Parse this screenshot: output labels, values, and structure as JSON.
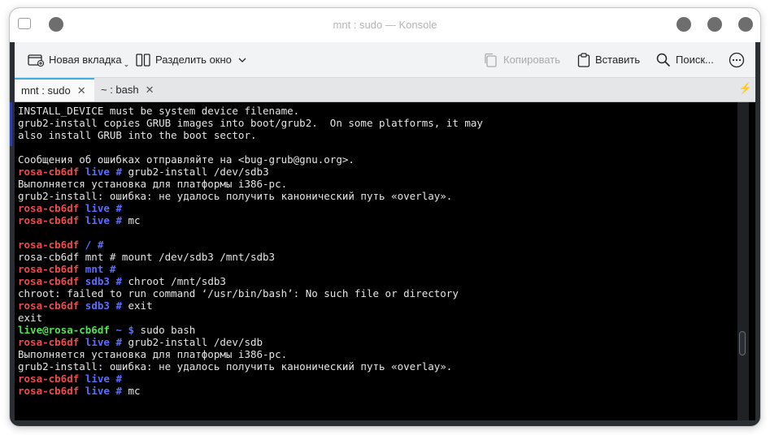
{
  "window": {
    "title": "mnt : sudo — Konsole"
  },
  "toolbar": {
    "new_tab": "Новая вкладка",
    "split_view": "Разделить окно",
    "copy": "Копировать",
    "paste": "Вставить",
    "find": "Поиск..."
  },
  "tabs": [
    {
      "label": "mnt : sudo",
      "active": true
    },
    {
      "label": "~ : bash",
      "active": false
    }
  ],
  "terminal": {
    "lines": [
      {
        "text": "INSTALL_DEVICE must be system device filename."
      },
      {
        "text": "grub2-install copies GRUB images into boot/grub2.  On some platforms, it may"
      },
      {
        "text": "also install GRUB into the boot sector."
      },
      {
        "text": ""
      },
      {
        "text": "Сообщения об ошибках отправляйте на <bug-grub@gnu.org>."
      },
      {
        "host": "rosa-cb6df",
        "dir": "live",
        "sym": "#",
        "cmd": "grub2-install /dev/sdb3"
      },
      {
        "text": "Выполняется установка для платформы i386-pc."
      },
      {
        "text": "grub2-install: ошибка: не удалось получить канонический путь «overlay»."
      },
      {
        "host": "rosa-cb6df",
        "dir": "live",
        "sym": "#",
        "cmd": ""
      },
      {
        "host": "rosa-cb6df",
        "dir": "live",
        "sym": "#",
        "cmd": "mc"
      },
      {
        "text": ""
      },
      {
        "host": "rosa-cb6df",
        "dir": "/",
        "sym": "#",
        "cmd": ""
      },
      {
        "text": "rosa-cb6df mnt # mount /dev/sdb3 /mnt/sdb3"
      },
      {
        "host": "rosa-cb6df",
        "dir": "mnt",
        "sym": "#",
        "cmd": ""
      },
      {
        "host": "rosa-cb6df",
        "dir": "sdb3",
        "sym": "#",
        "cmd": "chroot /mnt/sdb3"
      },
      {
        "text": "chroot: failed to run command ‘/usr/bin/bash’: No such file or directory"
      },
      {
        "host": "rosa-cb6df",
        "dir": "sdb3",
        "sym": "#",
        "cmd": "exit"
      },
      {
        "text": "exit"
      },
      {
        "userhost": "live@rosa-cb6df",
        "dir": "~",
        "sym": "$",
        "cmd": "sudo bash"
      },
      {
        "host": "rosa-cb6df",
        "dir": "live",
        "sym": "#",
        "cmd": "grub2-install /dev/sdb"
      },
      {
        "text": "Выполняется установка для платформы i386-pc."
      },
      {
        "text": "grub2-install: ошибка: не удалось получить канонический путь «overlay»."
      },
      {
        "host": "rosa-cb6df",
        "dir": "live",
        "sym": "#",
        "cmd": ""
      },
      {
        "host": "rosa-cb6df",
        "dir": "live",
        "sym": "#",
        "cmd": "mc"
      }
    ]
  },
  "colors": {
    "prompt_host": "#ee4b4b",
    "prompt_dir": "#5c6cff",
    "prompt_user": "#4fe44f",
    "active_tab_accent": "#3daee9"
  }
}
